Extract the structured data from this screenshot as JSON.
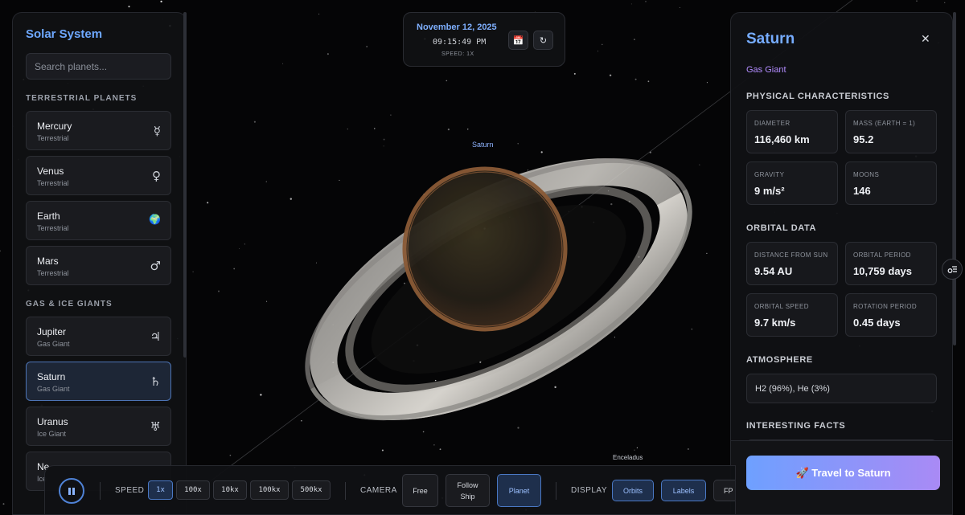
{
  "sidebar": {
    "title": "Solar System",
    "search_placeholder": "Search planets...",
    "sections": [
      {
        "label": "TERRESTRIAL PLANETS"
      },
      {
        "label": "GAS & ICE GIANTS"
      }
    ],
    "planets": [
      {
        "name": "Mercury",
        "type": "Terrestrial",
        "symbol": "☿"
      },
      {
        "name": "Venus",
        "type": "Terrestrial",
        "symbol": "♀"
      },
      {
        "name": "Earth",
        "type": "Terrestrial",
        "symbol": "🌍"
      },
      {
        "name": "Mars",
        "type": "Terrestrial",
        "symbol": "♂"
      },
      {
        "name": "Jupiter",
        "type": "Gas Giant",
        "symbol": "♃"
      },
      {
        "name": "Saturn",
        "type": "Gas Giant",
        "symbol": "♄",
        "active": true
      },
      {
        "name": "Uranus",
        "type": "Ice Giant",
        "symbol": "♅"
      },
      {
        "name": "Ne",
        "type": "Ice",
        "symbol": ""
      }
    ]
  },
  "datetime": {
    "date": "November 12, 2025",
    "time": "09:15:49 PM",
    "speed": "SPEED: 1X",
    "calendar_icon": "calendar-icon",
    "reset_icon": "reset-icon"
  },
  "scene": {
    "planet_label": "Saturn",
    "moon_label": "Enceladus"
  },
  "info": {
    "title": "Saturn",
    "subtitle": "Gas Giant",
    "physical_heading": "PHYSICAL CHARACTERISTICS",
    "physical": [
      {
        "label": "DIAMETER",
        "value": "116,460 km"
      },
      {
        "label": "MASS (EARTH = 1)",
        "value": "95.2"
      },
      {
        "label": "GRAVITY",
        "value": "9 m/s²"
      },
      {
        "label": "MOONS",
        "value": "146"
      }
    ],
    "orbital_heading": "ORBITAL DATA",
    "orbital": [
      {
        "label": "DISTANCE FROM SUN",
        "value": "9.54 AU"
      },
      {
        "label": "ORBITAL PERIOD",
        "value": "10,759 days"
      },
      {
        "label": "ORBITAL SPEED",
        "value": "9.7 km/s"
      },
      {
        "label": "ROTATION PERIOD",
        "value": "0.45 days"
      }
    ],
    "atmosphere_heading": "ATMOSPHERE",
    "atmosphere": "H2 (96%), He (3%)",
    "facts_heading": "INTERESTING FACTS",
    "travel_button": "🚀 Travel to Saturn",
    "close_symbol": "✕"
  },
  "controls": {
    "speed_label": "SPEED",
    "speeds": [
      "1x",
      "100x",
      "10kx",
      "100kx",
      "500kx"
    ],
    "active_speed": "1x",
    "camera_label": "CAMERA",
    "camera_free": "Free",
    "camera_follow": "Follow Ship",
    "camera_planet": "Planet",
    "active_camera": "Planet",
    "display_label": "DISPLAY",
    "display_orbits": "Orbits",
    "display_labels": "Labels",
    "display_extra": "FP"
  },
  "colors": {
    "accent": "#6ea8ff",
    "gradient_start": "#6ea0ff",
    "gradient_end": "#a98af5",
    "subtitle": "#b28cff"
  }
}
